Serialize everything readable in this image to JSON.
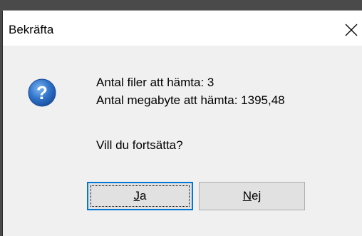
{
  "dialog": {
    "title": "Bekräfta",
    "close_icon": "close-icon",
    "icon": "question-icon",
    "messages": {
      "line1": "Antal filer att hämta: 3",
      "line2": "Antal megabyte att hämta: 1395,48",
      "line3": "Vill du fortsätta?"
    },
    "buttons": {
      "yes": {
        "accel": "J",
        "rest": "a"
      },
      "no": {
        "accel": "N",
        "rest": "ej"
      }
    }
  }
}
